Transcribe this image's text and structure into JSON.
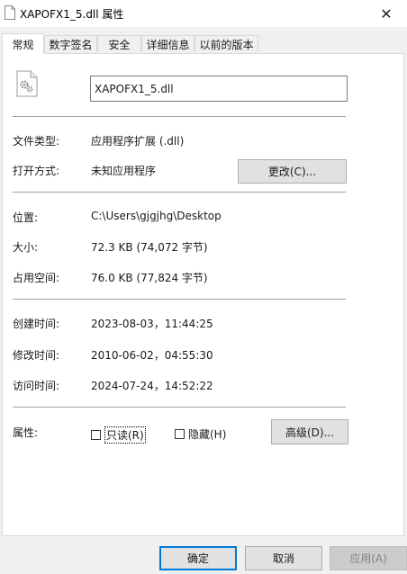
{
  "window": {
    "title": "XAPOFX1_5.dll 属性",
    "close_glyph": "✕"
  },
  "tabs": [
    {
      "label": "常规",
      "active": true
    },
    {
      "label": "数字签名",
      "active": false
    },
    {
      "label": "安全",
      "active": false
    },
    {
      "label": "详细信息",
      "active": false
    },
    {
      "label": "以前的版本",
      "active": false
    }
  ],
  "general": {
    "file_name": "XAPOFX1_5.dll",
    "file_type_label": "文件类型:",
    "file_type_value": "应用程序扩展 (.dll)",
    "open_with_label": "打开方式:",
    "open_with_value": "未知应用程序",
    "change_button": "更改(C)...",
    "location_label": "位置:",
    "location_value": "C:\\Users\\gjgjhg\\Desktop",
    "size_label": "大小:",
    "size_value": "72.3 KB (74,072 字节)",
    "size_on_disk_label": "占用空间:",
    "size_on_disk_value": "76.0 KB (77,824 字节)",
    "created_label": "创建时间:",
    "created_value": "2023-08-03，11:44:25",
    "modified_label": "修改时间:",
    "modified_value": "2010-06-02，04:55:30",
    "accessed_label": "访问时间:",
    "accessed_value": "2024-07-24，14:52:22",
    "attributes_label": "属性:",
    "readonly_label": "只读(R)",
    "readonly_checked": false,
    "hidden_label": "隐藏(H)",
    "hidden_checked": false,
    "advanced_button": "高级(D)..."
  },
  "footer": {
    "ok": "确定",
    "cancel": "取消",
    "apply": "应用(A)"
  },
  "icons": {
    "file": "dll-file-gear-icon"
  }
}
